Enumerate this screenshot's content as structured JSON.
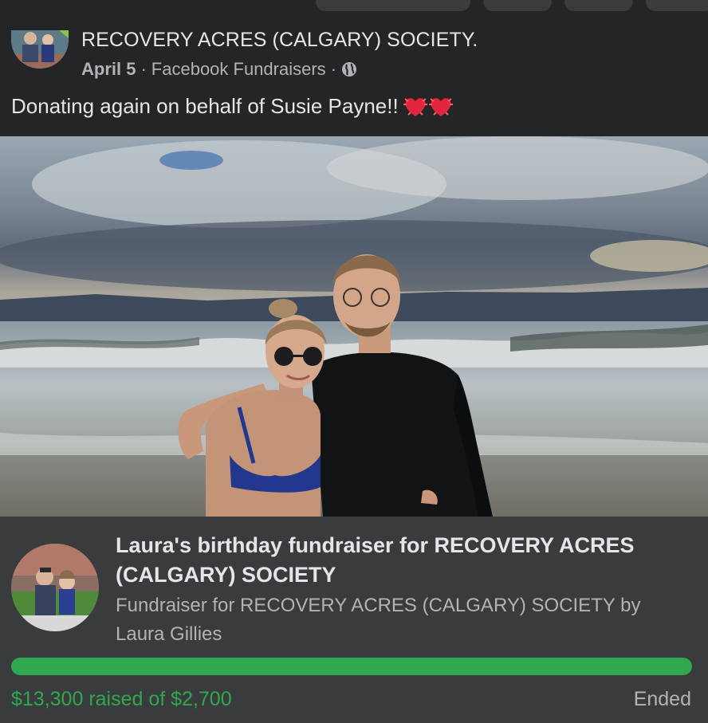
{
  "post": {
    "page_name": "RECOVERY ACRES (CALGARY) SOCIETY.",
    "date": "April 5",
    "separator": "·",
    "source": "Facebook Fundraisers",
    "privacy_icon": "globe-icon",
    "text": "Donating again on behalf of Susie Payne!!",
    "emoji": [
      "heart-icon",
      "heart-icon"
    ]
  },
  "fundraiser": {
    "title": "Laura's birthday fundraiser for RECOVERY ACRES (CALGARY) SOCIETY",
    "subtitle": "Fundraiser for RECOVERY ACRES (CALGARY) SOCIETY by Laura Gillies",
    "raised_text": "$13,300 raised of $2,700",
    "progress": 1.0,
    "status": "Ended"
  },
  "colors": {
    "background": "#242526",
    "card": "#3a3b3c",
    "accent_green": "#2fa84f",
    "text_primary": "#e4e6eb",
    "text_secondary": "#b0b3b8"
  }
}
